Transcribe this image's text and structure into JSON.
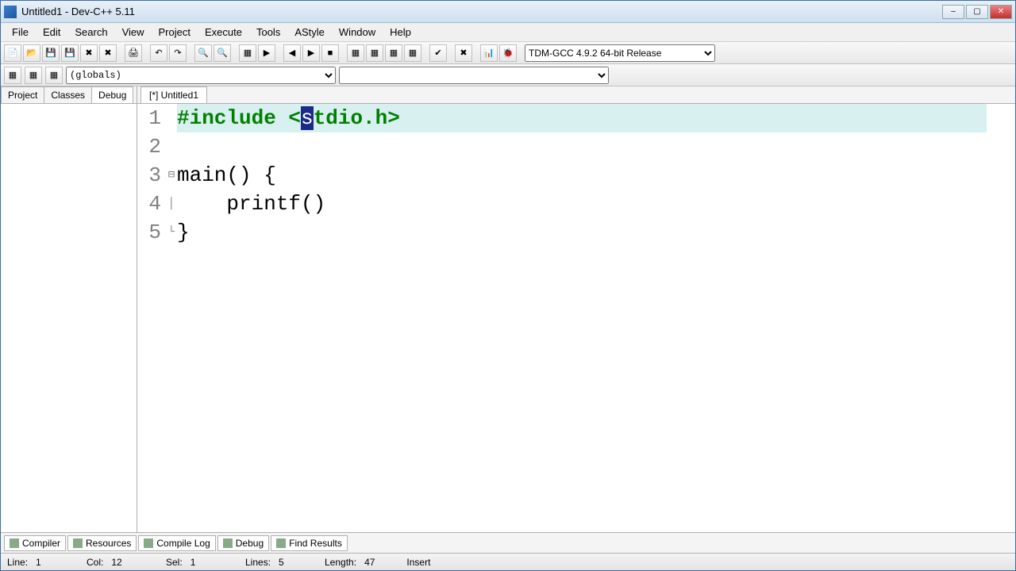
{
  "title": "Untitled1 - Dev-C++ 5.11",
  "menu": [
    "File",
    "Edit",
    "Search",
    "View",
    "Project",
    "Execute",
    "Tools",
    "AStyle",
    "Window",
    "Help"
  ],
  "compiler_selector": "TDM-GCC 4.9.2 64-bit Release",
  "scope_selector": "(globals)",
  "side_tabs": [
    "Project",
    "Classes",
    "Debug"
  ],
  "side_active": 2,
  "file_tab": "[*] Untitled1",
  "code": {
    "line1_pre": "#include <",
    "line1_sel": "s",
    "line1_post": "tdio.h>",
    "line3": "main() {",
    "line4": "    printf()",
    "line5": "}"
  },
  "bottom_tabs": [
    "Compiler",
    "Resources",
    "Compile Log",
    "Debug",
    "Find Results"
  ],
  "status": {
    "line_label": "Line:",
    "line": "1",
    "col_label": "Col:",
    "col": "12",
    "sel_label": "Sel:",
    "sel": "1",
    "lines_label": "Lines:",
    "lines": "5",
    "length_label": "Length:",
    "length": "47",
    "mode": "Insert"
  }
}
